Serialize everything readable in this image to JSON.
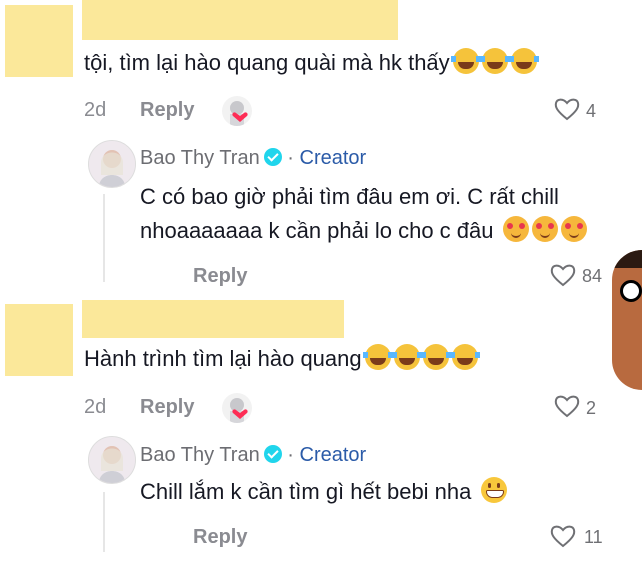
{
  "comments": [
    {
      "text": "tội, tìm lại hào quang quài mà hk thấy",
      "emojis": [
        "joy-icon",
        "joy-icon",
        "joy-icon"
      ],
      "age": "2d",
      "reply_label": "Reply",
      "likes": "4",
      "reply": {
        "author": "Bao Thy Tran",
        "separator": "·",
        "badge": "Creator",
        "text_line1": "C có bao giờ phải tìm đâu em ơi. C rất chill",
        "text_line2": "nhoaaaaaaa k cần phải lo cho c đâu",
        "emojis": [
          "smiling-hearts-icon",
          "smiling-hearts-icon",
          "smiling-hearts-icon"
        ],
        "reply_label": "Reply",
        "likes": "84"
      }
    },
    {
      "text": "Hành trình tìm lại hào quang",
      "emojis": [
        "joy-icon",
        "joy-icon",
        "joy-icon",
        "joy-icon"
      ],
      "age": "2d",
      "reply_label": "Reply",
      "likes": "2",
      "reply": {
        "author": "Bao Thy Tran",
        "separator": "·",
        "badge": "Creator",
        "text_line1": "Chill lắm k cần tìm gì hết bebi nha",
        "emojis": [
          "grinning-icon"
        ],
        "reply_label": "Reply",
        "likes": "11"
      }
    }
  ],
  "colors": {
    "redaction": "#fbe89a",
    "creator_badge": "#2b5ba8",
    "verified": "#20d5ec",
    "muted_text": "#8a8b91"
  }
}
